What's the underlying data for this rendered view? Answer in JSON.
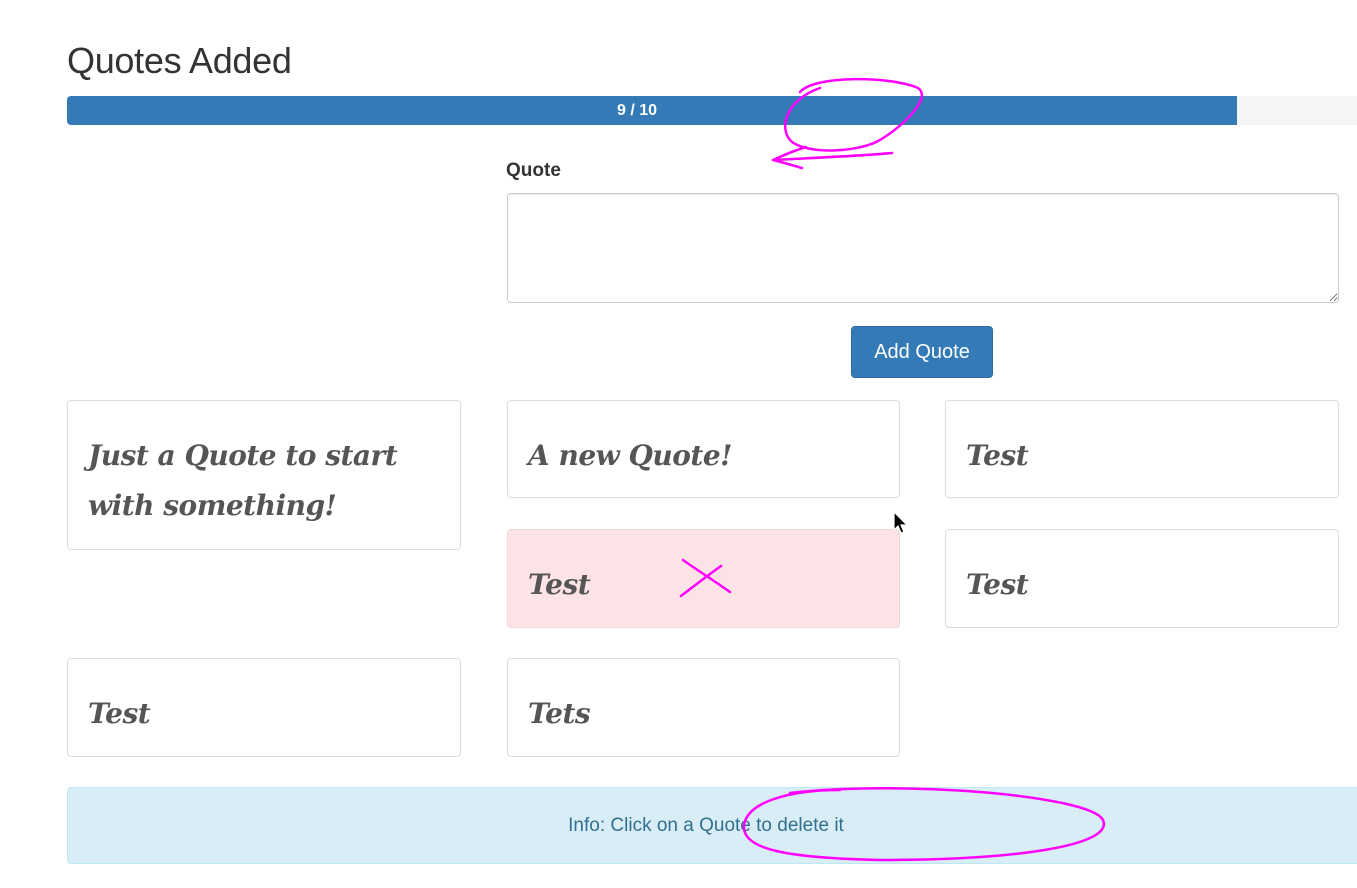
{
  "header": {
    "title": "Quotes Added"
  },
  "progress": {
    "label": "9 / 10",
    "value": 9,
    "max": 10
  },
  "form": {
    "label": "Quote",
    "input_value": "",
    "button_label": "Add Quote"
  },
  "quotes": [
    "Just a Quote to start with something!",
    "A new Quote!",
    "Test",
    "Test",
    "Test",
    "Test",
    "Tets"
  ],
  "info": {
    "text": "Info: Click on a Quote to delete it"
  },
  "colors": {
    "primary": "#337ab7",
    "danger_bg": "#fde2e6",
    "info_bg": "#d9edf7",
    "info_text": "#31708f",
    "annotation": "#ff00ff"
  }
}
